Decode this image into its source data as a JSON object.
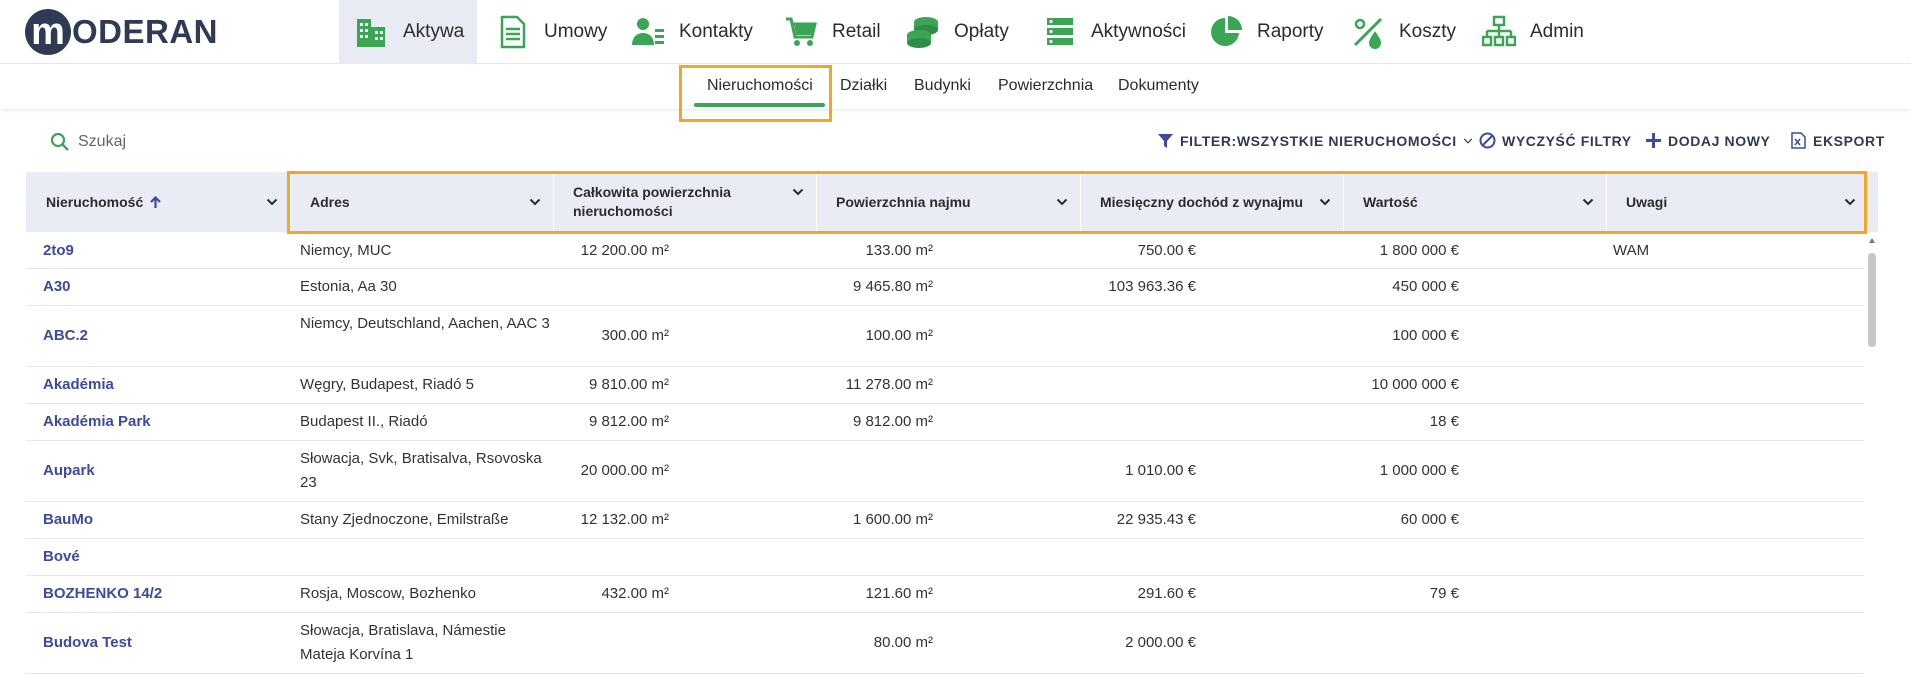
{
  "app": {
    "logo_letter": "m",
    "logo_text": "ODERAN"
  },
  "nav": [
    {
      "label": "Aktywa",
      "icon": "buildings-icon"
    },
    {
      "label": "Umowy",
      "icon": "document-icon"
    },
    {
      "label": "Kontakty",
      "icon": "contacts-icon"
    },
    {
      "label": "Retail",
      "icon": "cart-icon"
    },
    {
      "label": "Opłaty",
      "icon": "coins-icon"
    },
    {
      "label": "Aktywności",
      "icon": "activities-icon"
    },
    {
      "label": "Raporty",
      "icon": "pie-chart-icon"
    },
    {
      "label": "Koszty",
      "icon": "costs-icon"
    },
    {
      "label": "Admin",
      "icon": "org-chart-icon"
    }
  ],
  "subtabs": [
    "Nieruchomości",
    "Działki",
    "Budynki",
    "Powierzchnia",
    "Dokumenty"
  ],
  "search": {
    "placeholder": "Szukaj"
  },
  "toolbar": {
    "filter": "FILTER:WSZYSTKIE NIERUCHOMOŚCI",
    "clear": "WYCZYŚĆ FILTRY",
    "add": "DODAJ NOWY",
    "export": "EKSPORT"
  },
  "colors": {
    "accent_green": "#3aa655",
    "highlight": "#f2a623",
    "brand_navy": "#2f3a55",
    "link_blue": "#3c4aa0"
  },
  "table": {
    "columns": [
      "Nieruchomość",
      "Adres",
      "Całkowita powierzchnia nieruchomości",
      "Powierzchnia najmu",
      "Miesięczny dochód z wynajmu",
      "Wartość",
      "Uwagi"
    ],
    "sorted_column": "Nieruchomość",
    "rows": [
      {
        "name": "2to9",
        "address": "Niemcy, MUC",
        "area": "12 200.00 m²",
        "rent_area": "133.00 m²",
        "income": "750.00 €",
        "value": "1 800 000 €",
        "notes": "WAM"
      },
      {
        "name": "A30",
        "address": "Estonia, Aa 30",
        "area": "",
        "rent_area": "9 465.80 m²",
        "income": "103 963.36 €",
        "value": "450 000 €",
        "notes": ""
      },
      {
        "name": "ABC.2",
        "address": "Niemcy, Deutschland, Aachen, AAC 3",
        "area": "300.00 m²",
        "rent_area": "100.00 m²",
        "income": "",
        "value": "100 000 €",
        "notes": ""
      },
      {
        "name": "Akadémia",
        "address": "Węgry, Budapest, Riadó 5",
        "area": "9 810.00 m²",
        "rent_area": "11 278.00 m²",
        "income": "",
        "value": "10 000 000 €",
        "notes": ""
      },
      {
        "name": "Akadémia Park",
        "address": "Budapest II., Riadó",
        "area": "9 812.00 m²",
        "rent_area": "9 812.00 m²",
        "income": "",
        "value": "18 €",
        "notes": ""
      },
      {
        "name": "Aupark",
        "address": "Słowacja, Svk, Bratisalva, Rsovoska 23",
        "area": "20 000.00 m²",
        "rent_area": "",
        "income": "1 010.00 €",
        "value": "1 000 000 €",
        "notes": ""
      },
      {
        "name": "BauMo",
        "address": "Stany Zjednoczone, Emilstraße",
        "area": "12 132.00 m²",
        "rent_area": "1 600.00 m²",
        "income": "22 935.43 €",
        "value": "60 000 €",
        "notes": ""
      },
      {
        "name": "Bové",
        "address": "",
        "area": "",
        "rent_area": "",
        "income": "",
        "value": "",
        "notes": ""
      },
      {
        "name": "BOZHENKO 14/2",
        "address": "Rosja, Moscow, Bozhenko",
        "area": "432.00 m²",
        "rent_area": "121.60 m²",
        "income": "291.60 €",
        "value": "79 €",
        "notes": ""
      },
      {
        "name": "Budova Test",
        "address": "Słowacja, Bratislava, Námestie Mateja Korvína 1",
        "area": "",
        "rent_area": "80.00 m²",
        "income": "2 000.00 €",
        "value": "",
        "notes": ""
      }
    ]
  }
}
